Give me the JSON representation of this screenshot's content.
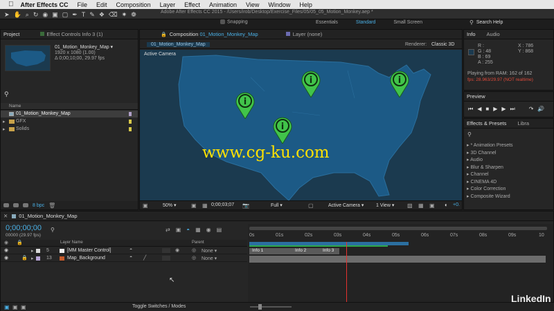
{
  "menubar": {
    "app": "After Effects CC",
    "items": [
      "File",
      "Edit",
      "Composition",
      "Layer",
      "Effect",
      "Animation",
      "View",
      "Window",
      "Help"
    ]
  },
  "toolbar": {
    "title": "Adobe After Effects CC 2015 - /Users/irob/Desktop/Exercise_Files/05/05_05_Motion_Monkey.aep *",
    "snapping": "Snapping",
    "workspaces": [
      "Essentials",
      "Standard",
      "Small Screen"
    ],
    "search": "Search Help"
  },
  "project": {
    "tab": "Project",
    "effect_tab": "Effect Controls Info 3 (1)",
    "comp_name": "01_Motion_Monkey_Map ▾",
    "comp_res": "1920 x 1080 (1.00)",
    "comp_dur": "Δ 0;00;10;00, 29.97 fps",
    "col_name": "Name",
    "items": [
      "01_Motion_Monkey_Map",
      "GFX",
      "Solids"
    ],
    "bpc": "8 bpc"
  },
  "comp": {
    "tab_prefix": "Composition",
    "tab_name": "01_Motion_Monkey_Map",
    "layer_tab": "Layer (none)",
    "subtab": "01_Motion_Monkey_Map",
    "renderer_label": "Renderer:",
    "renderer": "Classic 3D",
    "active_camera": "Active Camera",
    "watermark": "www.cg-ku.com",
    "zoom": "50%",
    "timecode": "0;00;03;07",
    "res": "Full",
    "view": "Active Camera",
    "views": "1 View",
    "offset": "+0."
  },
  "info": {
    "tab": "Info",
    "audio_tab": "Audio",
    "r": "R :",
    "g": "G : 48",
    "b": "B : 69",
    "a": "A : 255",
    "x": "X : 786",
    "y": "Y : 868",
    "ram": "Playing from RAM: 162 of 162",
    "fps": "fps: 28.963/29.97 (NOT realtime)"
  },
  "preview": {
    "tab": "Preview"
  },
  "effects": {
    "tab": "Effects & Presets",
    "libra_tab": "Libra",
    "items": [
      "* Animation Presets",
      "3D Channel",
      "Audio",
      "Blur & Sharpen",
      "Channel",
      "CINEMA 4D",
      "Color Correction",
      "Composite Wizard"
    ]
  },
  "timeline": {
    "tab": "01_Motion_Monkey_Map",
    "timecode": "0;00;00;00",
    "timecode_sub": "00000 (29.97 fps)",
    "col_layer": "Layer Name",
    "col_parent": "Parent",
    "layers": [
      {
        "num": "5",
        "name": "[MM Master Control]",
        "parent": "None",
        "color": "#d8d8d8"
      },
      {
        "num": "13",
        "name": "Map_Background",
        "parent": "None",
        "color": "#b9a6d8"
      }
    ],
    "ruler": [
      "0s",
      "01s",
      "02s",
      "03s",
      "04s",
      "05s",
      "06s",
      "07s",
      "08s",
      "09s",
      "10"
    ],
    "markers": [
      "Info 1",
      "Info 2",
      "Info 3"
    ],
    "toggle": "Toggle Switches / Modes"
  },
  "brand": "LinkedIn",
  "colors": {
    "accent": "#4ab0e6",
    "map_land": "#1c5a86",
    "map_water": "#1b3a4f",
    "pin": "#41c44a",
    "watermark": "#ffe100",
    "playhead": "#e4322f"
  },
  "icons": [
    "apple-icon",
    "search-icon",
    "location-pin-icon",
    "play-icon",
    "folder-icon",
    "trash-icon",
    "eye-icon",
    "lock-icon"
  ]
}
